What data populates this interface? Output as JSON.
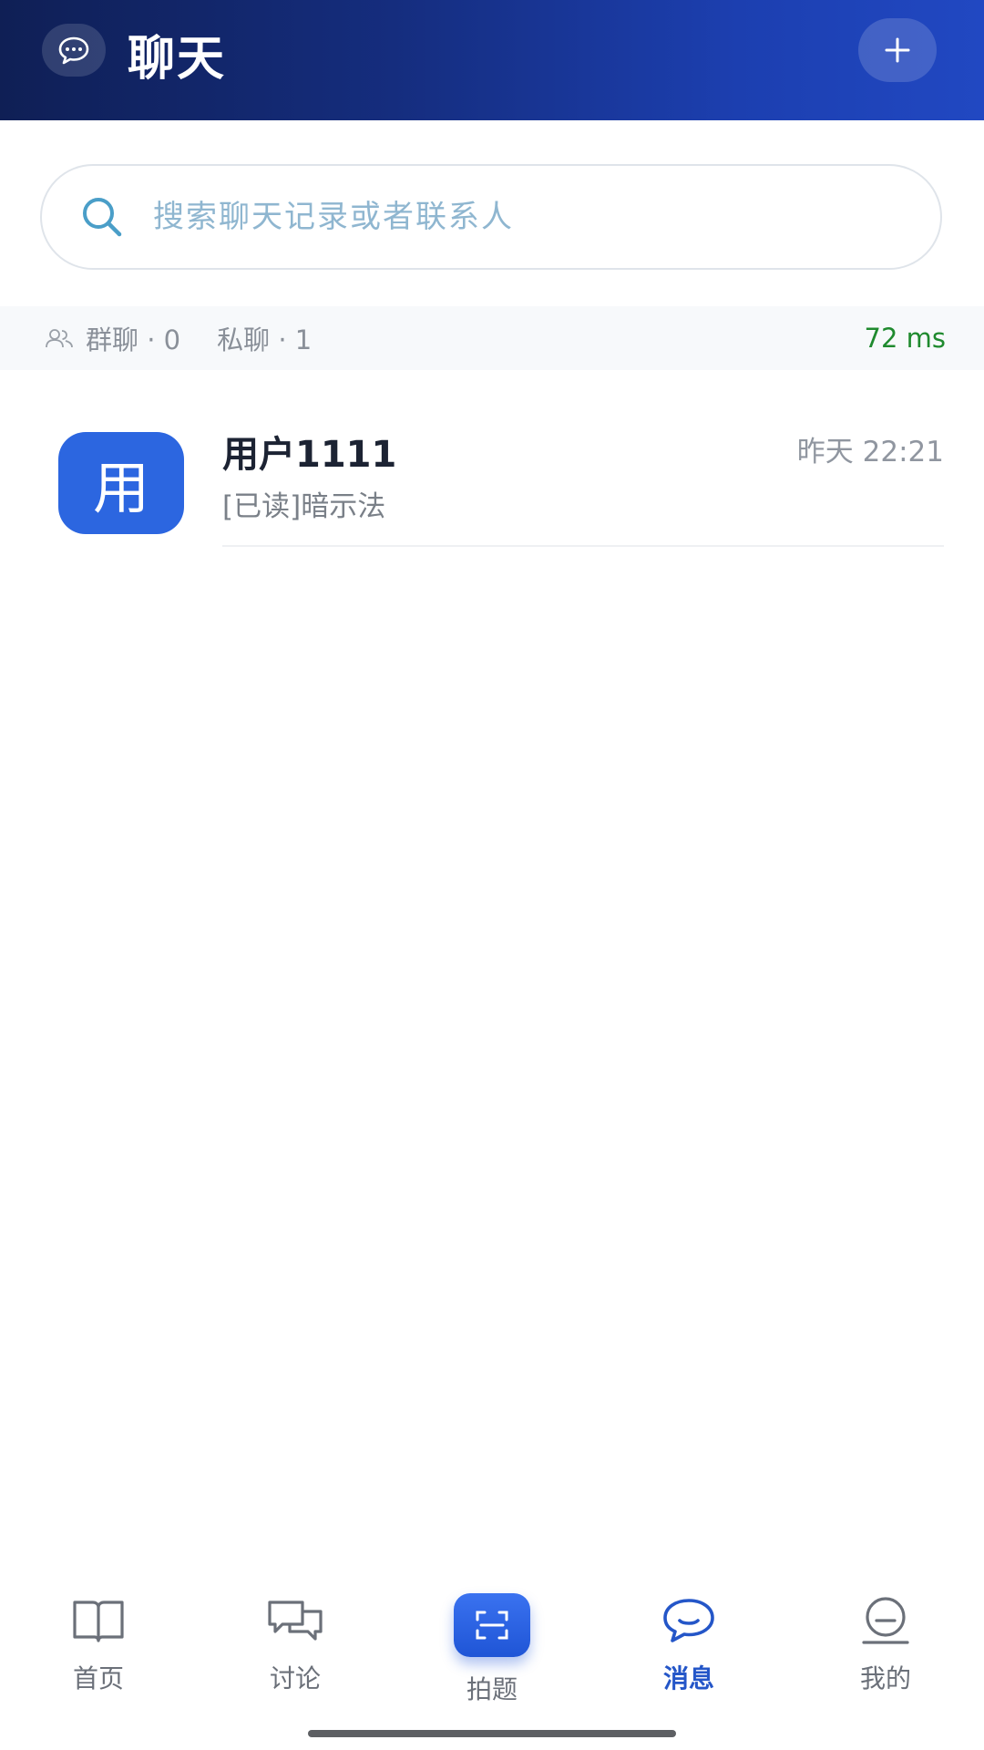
{
  "header": {
    "icon": "chat-bubble-icon",
    "title": "聊天",
    "add_icon": "plus-icon"
  },
  "search": {
    "icon": "search-icon",
    "placeholder": "搜索聊天记录或者联系人"
  },
  "stats": {
    "icon": "people-icon",
    "group_label": "群聊 · 0",
    "private_label": "私聊 · 1",
    "latency": "72 ms"
  },
  "conversations": [
    {
      "avatar_text": "用",
      "name": "用户1111",
      "time": "昨天 22:21",
      "preview": "[已读]暗示法"
    }
  ],
  "tabs": [
    {
      "label": "首页",
      "icon": "book-icon",
      "active": false
    },
    {
      "label": "讨论",
      "icon": "discussion-icon",
      "active": false
    },
    {
      "label": "拍题",
      "icon": "scan-icon",
      "active": false
    },
    {
      "label": "消息",
      "icon": "message-icon",
      "active": true
    },
    {
      "label": "我的",
      "icon": "profile-icon",
      "active": false
    }
  ],
  "colors": {
    "header_gradient_start": "#0f1f55",
    "header_gradient_end": "#2148c2",
    "accent_blue": "#2456c8",
    "avatar_blue": "#2c66e0",
    "latency_green": "#1f8a2e"
  }
}
